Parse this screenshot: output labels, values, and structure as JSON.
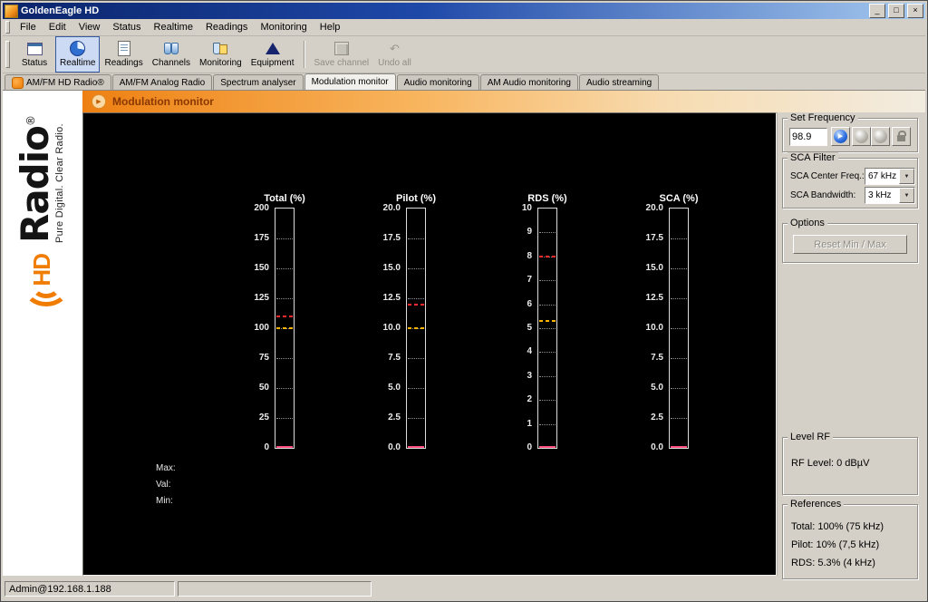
{
  "titlebar": {
    "title": "GoldenEagle HD",
    "minimize": "_",
    "maximize": "□",
    "close": "×"
  },
  "menu": {
    "items": [
      "File",
      "Edit",
      "View",
      "Status",
      "Realtime",
      "Readings",
      "Monitoring",
      "Help"
    ]
  },
  "toolbar": {
    "buttons": [
      {
        "label": "Status"
      },
      {
        "label": "Realtime"
      },
      {
        "label": "Readings"
      },
      {
        "label": "Channels"
      },
      {
        "label": "Monitoring"
      },
      {
        "label": "Equipment"
      },
      {
        "label": "Save channel"
      },
      {
        "label": "Undo all"
      }
    ]
  },
  "tabs": {
    "items": [
      {
        "label": "AM/FM HD Radio®"
      },
      {
        "label": "AM/FM Analog Radio"
      },
      {
        "label": "Spectrum analyser"
      },
      {
        "label": "Modulation monitor"
      },
      {
        "label": "Audio monitoring"
      },
      {
        "label": "AM Audio monitoring"
      },
      {
        "label": "Audio streaming"
      }
    ]
  },
  "banner": {
    "title": "Modulation monitor"
  },
  "logo": {
    "hd": "HD",
    "brand": "Radio",
    "registered": "®",
    "tagline": "Pure Digital. Clear Radio."
  },
  "meter_footer": {
    "max": "Max:",
    "val": "Val:",
    "min": "Min:"
  },
  "chart_data": {
    "type": "bar",
    "colors": {
      "max_marker": "#ff2b2b",
      "ref_marker": "#ffb400",
      "value_bar": "#ff4d7e",
      "tick_line": "#8f8f8f"
    },
    "meters": [
      {
        "title": "Total (%)",
        "min": 0,
        "max": 200,
        "ticks": [
          0,
          25,
          50,
          75,
          100,
          125,
          150,
          175,
          200
        ],
        "tick_labels": [
          "0",
          "25",
          "50",
          "75",
          "100",
          "125",
          "150",
          "175",
          "200"
        ],
        "max_marker": 110,
        "ref_marker": 100,
        "value": 0
      },
      {
        "title": "Pilot (%)",
        "min": 0,
        "max": 20,
        "ticks": [
          0,
          2.5,
          5,
          7.5,
          10,
          12.5,
          15,
          17.5,
          20
        ],
        "tick_labels": [
          "0.0",
          "2.5",
          "5.0",
          "7.5",
          "10.0",
          "12.5",
          "15.0",
          "17.5",
          "20.0"
        ],
        "max_marker": 12,
        "ref_marker": 10,
        "value": 0
      },
      {
        "title": "RDS (%)",
        "min": 0,
        "max": 10,
        "ticks": [
          0,
          1,
          2,
          3,
          4,
          5,
          6,
          7,
          8,
          9,
          10
        ],
        "tick_labels": [
          "0",
          "1",
          "2",
          "3",
          "4",
          "5",
          "6",
          "7",
          "8",
          "9",
          "10"
        ],
        "max_marker": 8,
        "ref_marker": 5.3,
        "value": 0
      },
      {
        "title": "SCA (%)",
        "min": 0,
        "max": 20,
        "ticks": [
          0,
          2.5,
          5,
          7.5,
          10,
          12.5,
          15,
          17.5,
          20
        ],
        "tick_labels": [
          "0.0",
          "2.5",
          "5.0",
          "7.5",
          "10.0",
          "12.5",
          "15.0",
          "17.5",
          "20.0"
        ],
        "max_marker": null,
        "ref_marker": null,
        "value": 0
      }
    ]
  },
  "set_frequency": {
    "title": "Set Frequency",
    "value": "98.9"
  },
  "sca_filter": {
    "title": "SCA Filter",
    "center_label": "SCA Center Freq.:",
    "center_value": "67 kHz",
    "bandwidth_label": "SCA Bandwidth:",
    "bandwidth_value": "3 kHz"
  },
  "options": {
    "title": "Options",
    "reset_label": "Reset Min / Max"
  },
  "level_rf": {
    "title": "Level RF",
    "value": "RF Level: 0 dBµV"
  },
  "references": {
    "title": "References",
    "lines": [
      "Total: 100% (75 kHz)",
      "Pilot: 10% (7,5 kHz)",
      "RDS: 5.3% (4 kHz)"
    ]
  },
  "statusbar": {
    "user": "Admin@192.168.1.188"
  },
  "glyphs": {
    "dropdown_arrow": "▼",
    "play": "▶",
    "undo": "↶",
    "banner_arrow": "▶"
  }
}
